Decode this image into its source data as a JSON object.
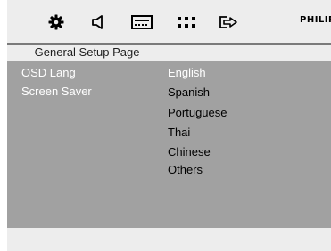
{
  "brand": "PHILIPS",
  "toolbar": {
    "icons": [
      {
        "name": "settings-gear-icon"
      },
      {
        "name": "audio-speaker-icon"
      },
      {
        "name": "display-screen-icon"
      },
      {
        "name": "grid-dots-icon"
      },
      {
        "name": "exit-arrow-icon"
      }
    ]
  },
  "page": {
    "title": "––  General Setup Page  ––"
  },
  "menu": {
    "items": [
      {
        "label": "OSD Lang"
      },
      {
        "label": "Screen Saver"
      }
    ],
    "options": [
      "English",
      "Spanish",
      "Portuguese",
      "Thai",
      "Chinese",
      "Others"
    ],
    "selected_option": "English"
  },
  "colors": {
    "panel_bg": "#a1a1a1",
    "bar_bg": "#ededed",
    "highlight_text": "#ffffff"
  }
}
